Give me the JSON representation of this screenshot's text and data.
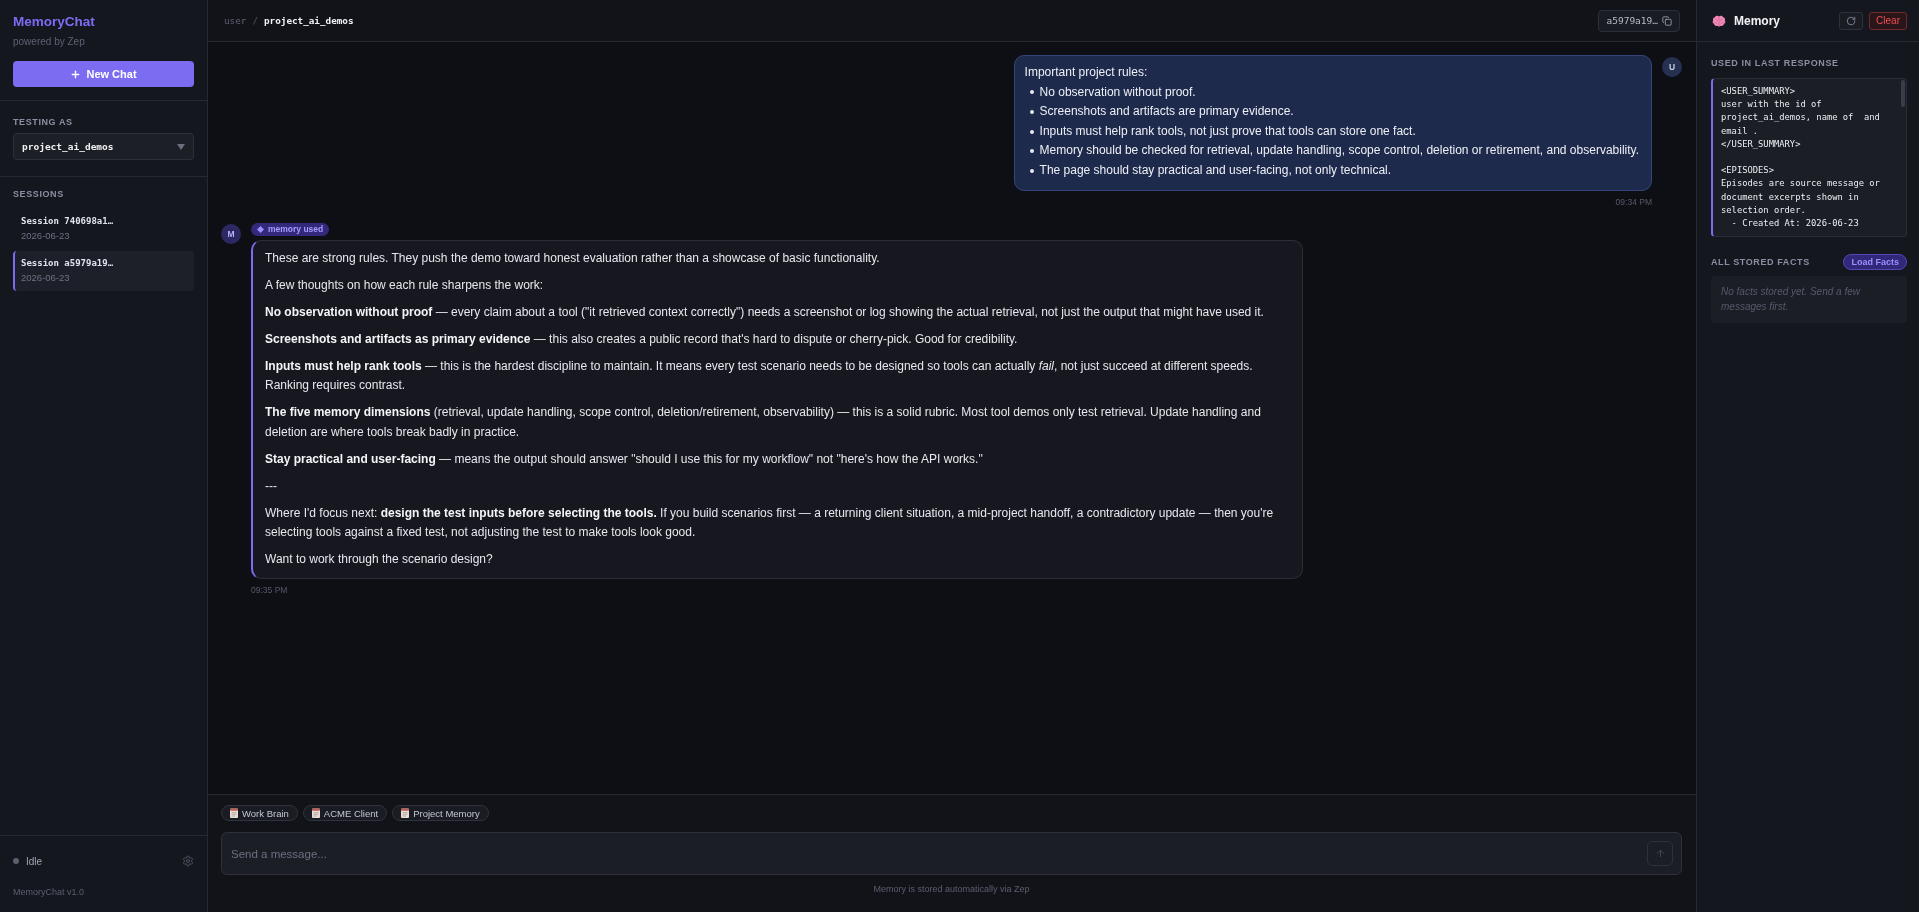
{
  "sidebar": {
    "brand": "MemoryChat",
    "tagline": "powered by Zep",
    "new_chat_button": "New Chat",
    "testing_as": {
      "label": "TESTING AS",
      "value": "project_ai_demos"
    },
    "sessions": {
      "label": "SESSIONS",
      "items": [
        {
          "title": "Session 740698a1…",
          "date": "2026-06-23",
          "selected": false
        },
        {
          "title": "Session a5979a19…",
          "date": "2026-06-23",
          "selected": true
        }
      ]
    },
    "status": {
      "kind": "idle",
      "label": "Idle"
    },
    "version": "MemoryChat v1.0"
  },
  "header": {
    "breadcrumb": [
      {
        "text": "user",
        "current": false
      },
      {
        "text": "project_ai_demos",
        "current": true
      }
    ],
    "separator": "/",
    "session_badge": "a5979a19…"
  },
  "messages": [
    {
      "kind": "user",
      "avatar": "U",
      "intro": "Important project rules:",
      "bullets": [
        "No observation without proof.",
        "Screenshots and artifacts are primary evidence.",
        "Inputs must help rank tools, not just prove that tools can store one fact.",
        "Memory should be checked for retrieval, update handling, scope control, deletion or retirement, and observability.",
        "The page should stay practical and user-facing, not only technical."
      ],
      "time": "09:34 PM"
    },
    {
      "kind": "assistant",
      "avatar": "M",
      "badge": "memory used",
      "paragraphs": [
        "These are strong rules. They push the demo toward honest evaluation rather than a showcase of basic functionality.",
        "A few thoughts on how each rule sharpens the work:",
        "**No observation without proof** — every claim about a tool (\"it retrieved context correctly\") needs a screenshot or log showing the actual retrieval, not just the output that might have used it.",
        "**Screenshots and artifacts as primary evidence** — this also creates a public record that's hard to dispute or cherry-pick. Good for credibility.",
        "**Inputs must help rank tools** — this is the hardest discipline to maintain. It means every test scenario needs to be designed so tools can actually *fail*, not just succeed at different speeds. Ranking requires contrast.",
        "**The five memory dimensions** (retrieval, update handling, scope control, deletion/retirement, observability) — this is a solid rubric. Most tool demos only test retrieval. Update handling and deletion are where tools break badly in practice.",
        "**Stay practical and user-facing** — means the output should answer \"should I use this for my workflow\" not \"here's how the API works.\"",
        "---",
        "Where I'd focus next: **design the test inputs before selecting the tools.** If you build scenarios first — a returning client situation, a mid-project handoff, a contradictory update — then you're selecting tools against a fixed test, not adjusting the test to make tools look good.",
        "Want to work through the scenario design?"
      ],
      "time": "09:35 PM"
    }
  ],
  "composer": {
    "chips": [
      {
        "label": "Work Brain"
      },
      {
        "label": "ACME Client"
      },
      {
        "label": "Project Memory"
      }
    ],
    "placeholder": "Send a message...",
    "send_button": {
      "disabled": true
    },
    "footnote": "Memory is stored automatically via Zep"
  },
  "memory_panel": {
    "title": "Memory",
    "clear_button": "Clear",
    "used_section": {
      "label": "USED IN LAST RESPONSE",
      "context": "<USER_SUMMARY>\nuser with the id of\nproject_ai_demos, name of  and\nemail .\n</USER_SUMMARY>\n\n<EPISODES>\nEpisodes are source message or\ndocument excerpts shown in\nselection order.\n  - Created At: 2026-06-23"
    },
    "facts_section": {
      "label": "ALL STORED FACTS",
      "load_button": "Load Facts",
      "empty_text": "No facts stored yet. Send a few messages first."
    }
  }
}
